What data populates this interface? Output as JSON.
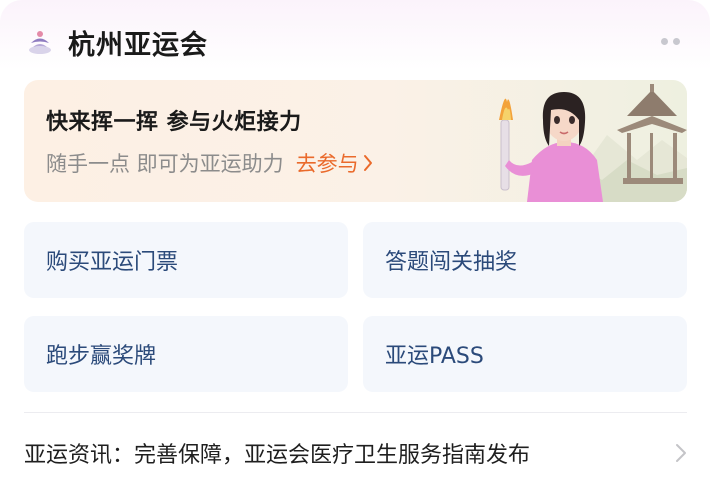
{
  "header": {
    "title": "杭州亚运会",
    "logo_icon": "asian-games-logo-icon",
    "more_icon": "more-dots-icon"
  },
  "banner": {
    "title": "快来挥一挥 参与火炬接力",
    "subtitle": "随手一点 即可为亚运助力",
    "cta_label": "去参与",
    "cta_icon": "chevron-right-icon",
    "cta_color": "#ea6a2b",
    "art": "torchbearer-with-pavilion-illustration"
  },
  "tiles": [
    {
      "label": "购买亚运门票"
    },
    {
      "label": "答题闯关抽奖"
    },
    {
      "label": "跑步赢奖牌"
    },
    {
      "label": "亚运PASS"
    }
  ],
  "news": {
    "text": "亚运资讯：完善保障，亚运会医疗卫生服务指南发布",
    "arrow_icon": "chevron-right-icon"
  },
  "colors": {
    "tile_bg": "#f4f7fc",
    "tile_text": "#2b4a7a"
  }
}
